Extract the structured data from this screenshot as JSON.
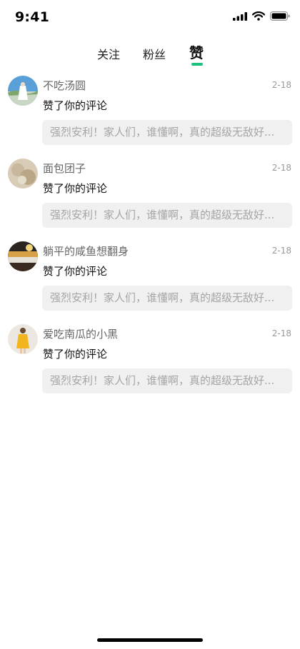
{
  "status": {
    "time": "9:41"
  },
  "tabs": [
    {
      "label": "关注"
    },
    {
      "label": "粉丝"
    },
    {
      "label": "赞"
    }
  ],
  "items": [
    {
      "name": "不吃汤圆",
      "date": "2-18",
      "action": "赞了你的评论",
      "quote": "强烈安利！家人们，谁懂啊，真的超级无敌好..."
    },
    {
      "name": "面包团子",
      "date": "2-18",
      "action": "赞了你的评论",
      "quote": "强烈安利！家人们，谁懂啊，真的超级无敌好..."
    },
    {
      "name": "躺平的咸鱼想翻身",
      "date": "2-18",
      "action": "赞了你的评论",
      "quote": "强烈安利！家人们，谁懂啊，真的超级无敌好..."
    },
    {
      "name": "爱吃南瓜的小黑",
      "date": "2-18",
      "action": "赞了你的评论",
      "quote": "强烈安利！家人们，谁懂啊，真的超级无敌好..."
    }
  ],
  "colors": {
    "accent": "#19c37d",
    "quote_bg": "#f0f0f0"
  }
}
